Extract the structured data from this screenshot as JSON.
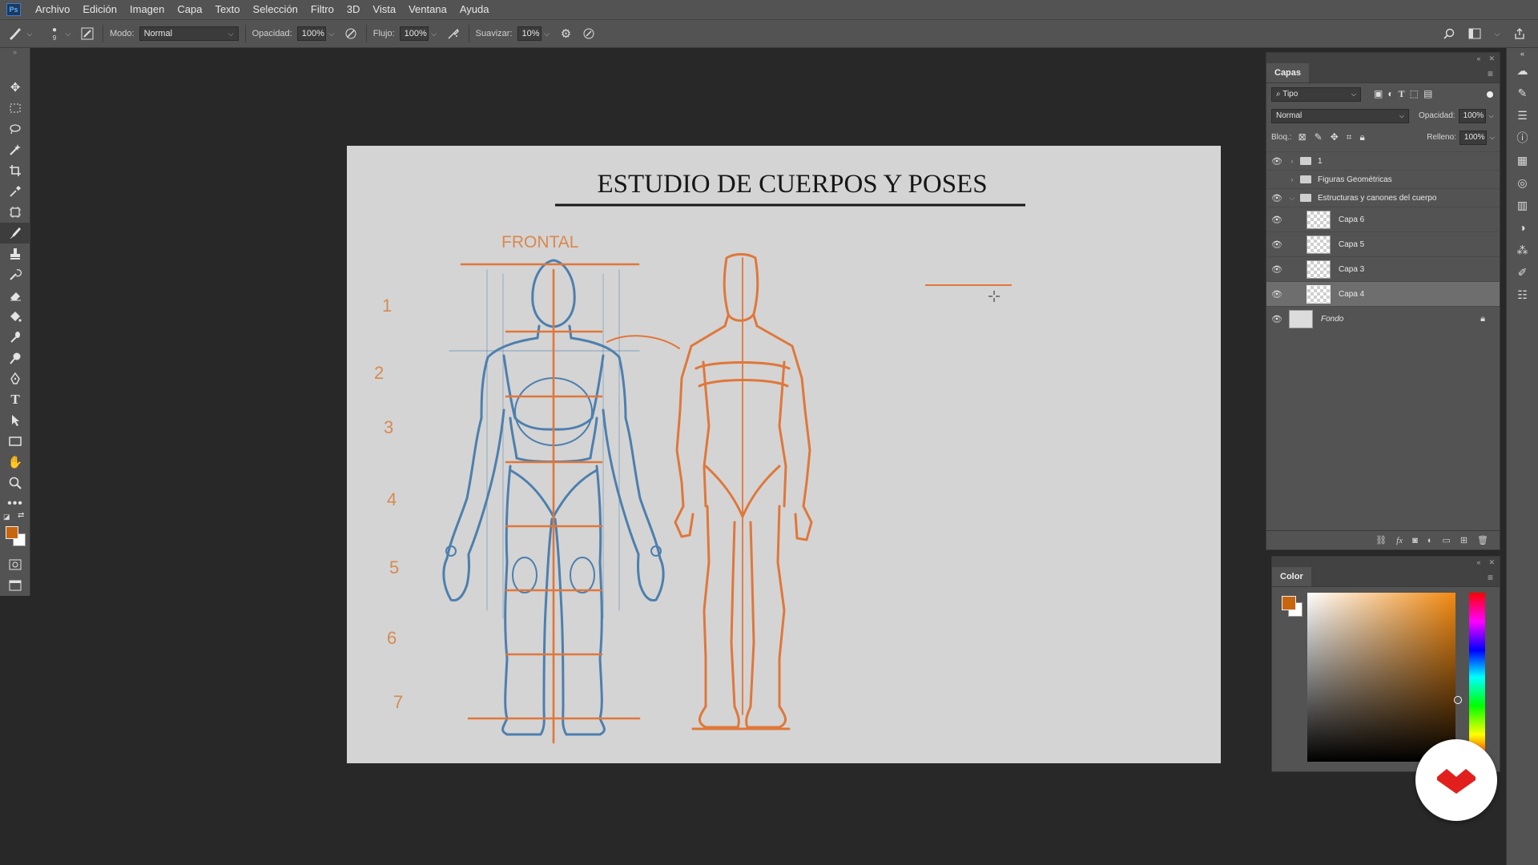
{
  "menubar": {
    "app_logo": "Ps",
    "items": [
      "Archivo",
      "Edición",
      "Imagen",
      "Capa",
      "Texto",
      "Selección",
      "Filtro",
      "3D",
      "Vista",
      "Ventana",
      "Ayuda"
    ]
  },
  "options": {
    "brush_size": "9",
    "mode_label": "Modo:",
    "mode_value": "Normal",
    "opacity_label": "Opacidad:",
    "opacity_value": "100%",
    "flow_label": "Flujo:",
    "flow_value": "100%",
    "smoothing_label": "Suavizar:",
    "smoothing_value": "10%"
  },
  "canvas": {
    "title": "ESTUDIO DE CUERPOS Y POSES",
    "label_frontal": "FRONTAL",
    "head_numbers": [
      "1",
      "2",
      "3",
      "4",
      "5",
      "6",
      "7"
    ],
    "colors": {
      "paper": "#d4d4d4",
      "blue_sketch": "#4d7fae",
      "orange_sketch": "#e0773a"
    }
  },
  "layers_panel": {
    "tab": "Capas",
    "filter_type": "Tipo",
    "blend_mode": "Normal",
    "opacity_label": "Opacidad:",
    "opacity_value": "100%",
    "lock_label": "Bloq.:",
    "fill_label": "Relleno:",
    "fill_value": "100%",
    "layers": [
      {
        "name": "1",
        "kind": "group",
        "visible": true,
        "expanded": false
      },
      {
        "name": "Figuras Geométricas",
        "kind": "group",
        "visible": false,
        "expanded": false
      },
      {
        "name": "Estructuras y canones del cuerpo",
        "kind": "group",
        "visible": true,
        "expanded": true
      },
      {
        "name": "Capa 6",
        "kind": "layer",
        "visible": true
      },
      {
        "name": "Capa 5",
        "kind": "layer",
        "visible": true
      },
      {
        "name": "Capa 3",
        "kind": "layer",
        "visible": true
      },
      {
        "name": "Capa 4",
        "kind": "layer",
        "visible": true,
        "selected": true
      },
      {
        "name": "Fondo",
        "kind": "background",
        "visible": true,
        "locked": true
      }
    ]
  },
  "color_panel": {
    "tab": "Color",
    "foreground": "#c8650f",
    "background": "#ffffff"
  },
  "accent_colors": {
    "brand_red": "#e1201e"
  }
}
